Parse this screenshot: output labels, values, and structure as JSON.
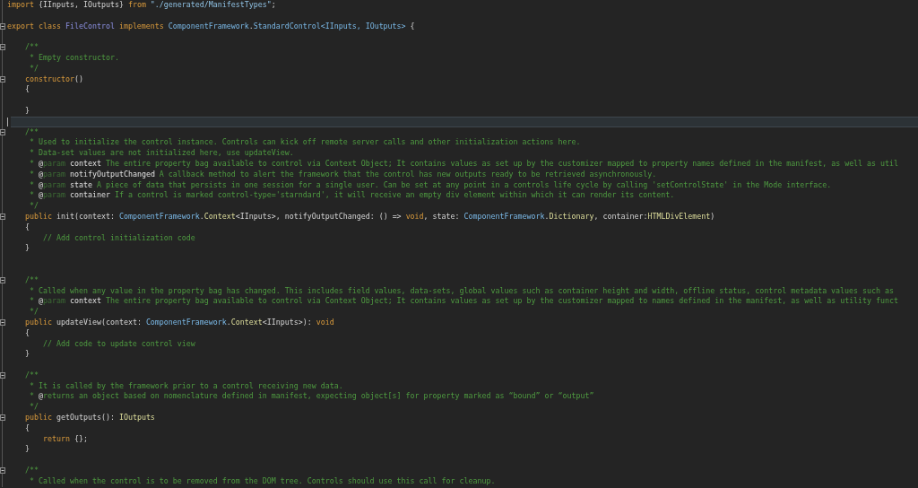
{
  "editor": {
    "lines": [
      {
        "fold": false,
        "current": false,
        "tokens": [
          {
            "kind": "kw",
            "text": "import"
          },
          {
            "kind": "plain",
            "text": " {IInputs, IOutputs} "
          },
          {
            "kind": "kw",
            "text": "from"
          },
          {
            "kind": "str",
            "text": " \"./generated/ManifestTypes\""
          },
          {
            "kind": "plain",
            "text": ";"
          }
        ]
      },
      {
        "fold": false,
        "current": false
      },
      {
        "fold": true,
        "current": false,
        "tokens": [
          {
            "kind": "kw",
            "text": "export class"
          },
          {
            "kind": "cls",
            "text": " FileControl "
          },
          {
            "kind": "kw",
            "text": "implements"
          },
          {
            "kind": "ns",
            "text": " ComponentFramework"
          },
          {
            "kind": "plain",
            "text": "."
          },
          {
            "kind": "ns",
            "text": "StandardControl<IInputs, IOutputs>"
          },
          {
            "kind": "plain",
            "text": " {"
          }
        ]
      },
      {
        "fold": false,
        "current": false
      },
      {
        "fold": true,
        "current": false,
        "tokens": [
          {
            "kind": "cm",
            "text": "    /**"
          }
        ]
      },
      {
        "fold": false,
        "current": false,
        "tokens": [
          {
            "kind": "cm",
            "text": "     * Empty constructor."
          }
        ]
      },
      {
        "fold": false,
        "current": false,
        "tokens": [
          {
            "kind": "cm",
            "text": "     */"
          }
        ]
      },
      {
        "fold": true,
        "current": false,
        "tokens": [
          {
            "kind": "kw",
            "text": "    constructor"
          },
          {
            "kind": "plain",
            "text": "()"
          }
        ]
      },
      {
        "fold": false,
        "current": false,
        "tokens": [
          {
            "kind": "plain",
            "text": "    {"
          }
        ]
      },
      {
        "fold": false,
        "current": false
      },
      {
        "fold": false,
        "current": false,
        "tokens": [
          {
            "kind": "plain",
            "text": "    }"
          }
        ]
      },
      {
        "fold": false,
        "current": true
      },
      {
        "fold": true,
        "current": false,
        "tokens": [
          {
            "kind": "cm",
            "text": "    /**"
          }
        ]
      },
      {
        "fold": false,
        "current": false,
        "tokens": [
          {
            "kind": "cm",
            "text": "     * Used to initialize the control instance. Controls can kick off remote server calls and other initialization actions here."
          }
        ]
      },
      {
        "fold": false,
        "current": false,
        "tokens": [
          {
            "kind": "cm",
            "text": "     * Data-set values are not initialized here, use updateView."
          }
        ]
      },
      {
        "fold": false,
        "current": false,
        "tokens": [
          {
            "kind": "cm",
            "text": "     * "
          },
          {
            "kind": "pname",
            "text": "@"
          },
          {
            "kind": "tag",
            "text": "param"
          },
          {
            "kind": "pname",
            "text": " context"
          },
          {
            "kind": "cm",
            "text": " The entire property bag available to control via Context Object; It contains values as set up by the customizer mapped to property names defined in the manifest, as well as util"
          }
        ]
      },
      {
        "fold": false,
        "current": false,
        "tokens": [
          {
            "kind": "cm",
            "text": "     * "
          },
          {
            "kind": "pname",
            "text": "@"
          },
          {
            "kind": "tag",
            "text": "param"
          },
          {
            "kind": "pname",
            "text": " notifyOutputChanged"
          },
          {
            "kind": "cm",
            "text": " A callback method to alert the framework that the control has new outputs ready to be retrieved asynchronously."
          }
        ]
      },
      {
        "fold": false,
        "current": false,
        "tokens": [
          {
            "kind": "cm",
            "text": "     * "
          },
          {
            "kind": "pname",
            "text": "@"
          },
          {
            "kind": "tag",
            "text": "param"
          },
          {
            "kind": "pname",
            "text": " state"
          },
          {
            "kind": "cm",
            "text": " A piece of data that persists in one session for a single user. Can be set at any point in a controls life cycle by calling 'setControlState' in the Mode interface."
          }
        ]
      },
      {
        "fold": false,
        "current": false,
        "tokens": [
          {
            "kind": "cm",
            "text": "     * "
          },
          {
            "kind": "pname",
            "text": "@"
          },
          {
            "kind": "tag",
            "text": "param"
          },
          {
            "kind": "pname",
            "text": " container"
          },
          {
            "kind": "cm",
            "text": " If a control is marked control-type='starndard', it will receive an empty div element within which it can render its content."
          }
        ]
      },
      {
        "fold": false,
        "current": false,
        "tokens": [
          {
            "kind": "cm",
            "text": "     */"
          }
        ]
      },
      {
        "fold": true,
        "current": false,
        "tokens": [
          {
            "kind": "kw",
            "text": "    public"
          },
          {
            "kind": "plain",
            "text": " init(context: "
          },
          {
            "kind": "ns",
            "text": "ComponentFramework"
          },
          {
            "kind": "plain",
            "text": "."
          },
          {
            "kind": "type",
            "text": "Context"
          },
          {
            "kind": "plain",
            "text": "<IInputs>, notifyOutputChanged: () => "
          },
          {
            "kind": "kw",
            "text": "void"
          },
          {
            "kind": "plain",
            "text": ", state: "
          },
          {
            "kind": "ns",
            "text": "ComponentFramework"
          },
          {
            "kind": "plain",
            "text": "."
          },
          {
            "kind": "type",
            "text": "Dictionary"
          },
          {
            "kind": "plain",
            "text": ", container:"
          },
          {
            "kind": "type",
            "text": "HTMLDivElement"
          },
          {
            "kind": "plain",
            "text": ")"
          }
        ]
      },
      {
        "fold": false,
        "current": false,
        "tokens": [
          {
            "kind": "plain",
            "text": "    {"
          }
        ]
      },
      {
        "fold": false,
        "current": false,
        "tokens": [
          {
            "kind": "cm",
            "text": "        // Add control initialization code"
          }
        ]
      },
      {
        "fold": false,
        "current": false,
        "tokens": [
          {
            "kind": "plain",
            "text": "    }"
          }
        ]
      },
      {
        "fold": false,
        "current": false
      },
      {
        "fold": false,
        "current": false
      },
      {
        "fold": true,
        "current": false,
        "tokens": [
          {
            "kind": "cm",
            "text": "    /**"
          }
        ]
      },
      {
        "fold": false,
        "current": false,
        "tokens": [
          {
            "kind": "cm",
            "text": "     * Called when any value in the property bag has changed. This includes field values, data-sets, global values such as container height and width, offline status, control metadata values such as"
          }
        ]
      },
      {
        "fold": false,
        "current": false,
        "tokens": [
          {
            "kind": "cm",
            "text": "     * "
          },
          {
            "kind": "pname",
            "text": "@"
          },
          {
            "kind": "tag",
            "text": "param"
          },
          {
            "kind": "pname",
            "text": " context"
          },
          {
            "kind": "cm",
            "text": " The entire property bag available to control via Context Object; It contains values as set up by the customizer mapped to names defined in the manifest, as well as utility funct"
          }
        ]
      },
      {
        "fold": false,
        "current": false,
        "tokens": [
          {
            "kind": "cm",
            "text": "     */"
          }
        ]
      },
      {
        "fold": true,
        "current": false,
        "tokens": [
          {
            "kind": "kw",
            "text": "    public"
          },
          {
            "kind": "plain",
            "text": " updateView(context: "
          },
          {
            "kind": "ns",
            "text": "ComponentFramework"
          },
          {
            "kind": "plain",
            "text": "."
          },
          {
            "kind": "type",
            "text": "Context"
          },
          {
            "kind": "plain",
            "text": "<IInputs>): "
          },
          {
            "kind": "kw",
            "text": "void"
          }
        ]
      },
      {
        "fold": false,
        "current": false,
        "tokens": [
          {
            "kind": "plain",
            "text": "    {"
          }
        ]
      },
      {
        "fold": false,
        "current": false,
        "tokens": [
          {
            "kind": "cm",
            "text": "        // Add code to update control view"
          }
        ]
      },
      {
        "fold": false,
        "current": false,
        "tokens": [
          {
            "kind": "plain",
            "text": "    }"
          }
        ]
      },
      {
        "fold": false,
        "current": false
      },
      {
        "fold": true,
        "current": false,
        "tokens": [
          {
            "kind": "cm",
            "text": "    /**"
          }
        ]
      },
      {
        "fold": false,
        "current": false,
        "tokens": [
          {
            "kind": "cm",
            "text": "     * It is called by the framework prior to a control receiving new data."
          }
        ]
      },
      {
        "fold": false,
        "current": false,
        "tokens": [
          {
            "kind": "cm",
            "text": "     * "
          },
          {
            "kind": "pname",
            "text": "@"
          },
          {
            "kind": "cm",
            "text": "returns an object based on nomenclature defined in manifest, expecting object[s] for property marked as “bound” or “output”"
          }
        ]
      },
      {
        "fold": false,
        "current": false,
        "tokens": [
          {
            "kind": "cm",
            "text": "     */"
          }
        ]
      },
      {
        "fold": true,
        "current": false,
        "tokens": [
          {
            "kind": "kw",
            "text": "    public"
          },
          {
            "kind": "plain",
            "text": " getOutputs(): "
          },
          {
            "kind": "type",
            "text": "IOutputs"
          }
        ]
      },
      {
        "fold": false,
        "current": false,
        "tokens": [
          {
            "kind": "plain",
            "text": "    {"
          }
        ]
      },
      {
        "fold": false,
        "current": false,
        "tokens": [
          {
            "kind": "kw",
            "text": "        return"
          },
          {
            "kind": "plain",
            "text": " {};"
          }
        ]
      },
      {
        "fold": false,
        "current": false,
        "tokens": [
          {
            "kind": "plain",
            "text": "    }"
          }
        ]
      },
      {
        "fold": false,
        "current": false
      },
      {
        "fold": true,
        "current": false,
        "tokens": [
          {
            "kind": "cm",
            "text": "    /**"
          }
        ]
      },
      {
        "fold": false,
        "current": false,
        "tokens": [
          {
            "kind": "cm",
            "text": "     * Called when the control is to be removed from the DOM tree. Controls should use this call for cleanup."
          }
        ]
      }
    ]
  }
}
